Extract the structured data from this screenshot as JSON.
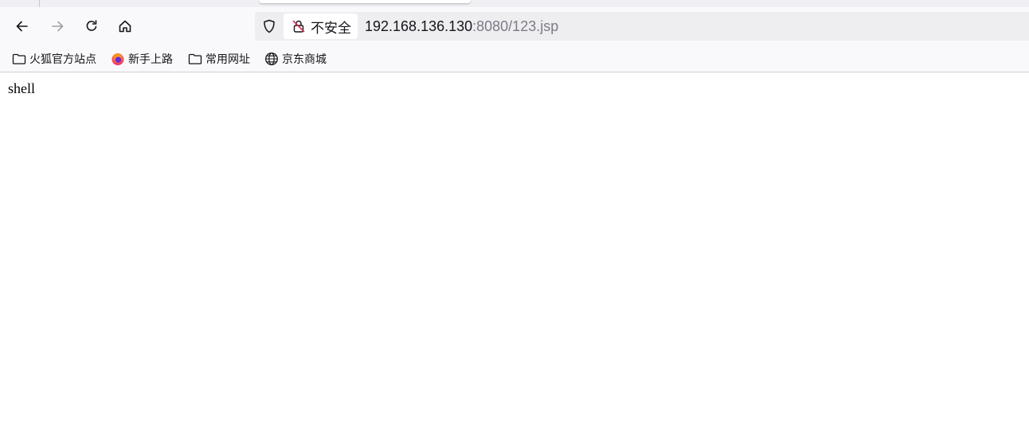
{
  "navbar": {
    "security_label": "不安全",
    "url_host": "192.168.136.130",
    "url_rest": ":8080/123.jsp"
  },
  "bookmarks": [
    {
      "label": "火狐官方站点",
      "icon": "folder-icon"
    },
    {
      "label": "新手上路",
      "icon": "firefox-icon"
    },
    {
      "label": "常用网址",
      "icon": "folder-icon"
    },
    {
      "label": "京东商城",
      "icon": "globe-icon"
    }
  ],
  "page": {
    "body_text": "shell"
  },
  "colors": {
    "toolbar_bg": "#f9f9fb",
    "urlbar_bg": "#eeeef1",
    "insecure_red": "#e22850",
    "url_gray": "#7b7b85"
  }
}
